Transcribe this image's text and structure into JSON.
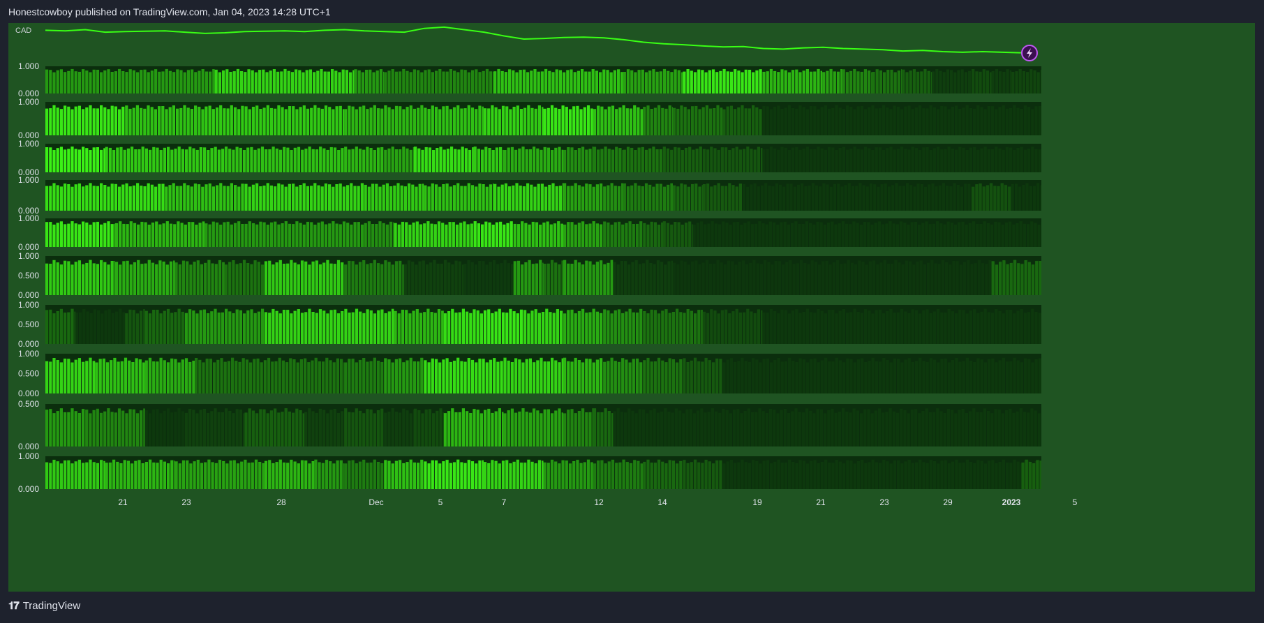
{
  "header": {
    "title": "Honestcowboy published on TradingView.com, Jan 04, 2023 14:28 UTC+1"
  },
  "footer": {
    "brand": "TradingView"
  },
  "colors": {
    "background": "#1e222d",
    "pane": "#1f5422",
    "line": "#39ff14",
    "bright": "#3bf016",
    "dark": "#0b2e0d",
    "badge": "#c158f5"
  },
  "icons": {
    "badge": "lightning-icon",
    "logo": "tradingview-logo-icon"
  },
  "chart_data": {
    "type": "heatmap",
    "price_label": "CAD",
    "x_ticks": [
      "21",
      "23",
      "28",
      "Dec",
      "5",
      "7",
      "12",
      "14",
      "19",
      "21",
      "23",
      "29",
      "2023",
      "5"
    ],
    "bold_ticks": [
      "2023"
    ],
    "price_line_shape": [
      0.12,
      0.14,
      0.1,
      0.18,
      0.16,
      0.15,
      0.14,
      0.18,
      0.22,
      0.2,
      0.16,
      0.15,
      0.14,
      0.16,
      0.12,
      0.1,
      0.14,
      0.16,
      0.18,
      0.06,
      0.02,
      0.1,
      0.18,
      0.3,
      0.4,
      0.38,
      0.35,
      0.34,
      0.36,
      0.42,
      0.5,
      0.55,
      0.58,
      0.62,
      0.65,
      0.64,
      0.7,
      0.72,
      0.68,
      0.66,
      0.7,
      0.72,
      0.74,
      0.78,
      0.76,
      0.8,
      0.82,
      0.8,
      0.82,
      0.84
    ],
    "panes": [
      {
        "ticks": [
          "1.000",
          "0.000"
        ],
        "segments": [
          [
            0.0,
            0.17,
            0.55
          ],
          [
            0.17,
            0.31,
            0.85
          ],
          [
            0.31,
            0.34,
            0.55
          ],
          [
            0.34,
            0.45,
            0.45
          ],
          [
            0.45,
            0.58,
            0.75
          ],
          [
            0.58,
            0.64,
            0.6
          ],
          [
            0.64,
            0.72,
            0.95
          ],
          [
            0.72,
            0.78,
            0.7
          ],
          [
            0.78,
            0.8,
            0.6
          ],
          [
            0.8,
            0.83,
            0.45
          ],
          [
            0.83,
            0.86,
            0.35
          ],
          [
            0.86,
            0.89,
            0.25
          ],
          [
            0.89,
            0.93,
            0.08
          ],
          [
            0.93,
            0.95,
            0.15
          ],
          [
            0.95,
            0.97,
            0.08
          ],
          [
            0.97,
            1.0,
            0.12
          ]
        ]
      },
      {
        "ticks": [
          "1.000",
          "0.000"
        ],
        "segments": [
          [
            0.0,
            0.08,
            0.95
          ],
          [
            0.08,
            0.16,
            0.75
          ],
          [
            0.16,
            0.3,
            0.8
          ],
          [
            0.3,
            0.38,
            0.7
          ],
          [
            0.38,
            0.44,
            0.75
          ],
          [
            0.44,
            0.48,
            0.85
          ],
          [
            0.48,
            0.5,
            0.8
          ],
          [
            0.5,
            0.55,
            0.95
          ],
          [
            0.55,
            0.6,
            0.75
          ],
          [
            0.6,
            0.63,
            0.45
          ],
          [
            0.63,
            0.68,
            0.35
          ],
          [
            0.68,
            0.72,
            0.25
          ],
          [
            0.72,
            1.0,
            0.05
          ]
        ]
      },
      {
        "ticks": [
          "1.000",
          "0.000"
        ],
        "segments": [
          [
            0.0,
            0.06,
            1.0
          ],
          [
            0.06,
            0.18,
            0.8
          ],
          [
            0.18,
            0.3,
            0.75
          ],
          [
            0.3,
            0.34,
            0.7
          ],
          [
            0.34,
            0.37,
            0.6
          ],
          [
            0.37,
            0.43,
            0.9
          ],
          [
            0.43,
            0.46,
            0.8
          ],
          [
            0.46,
            0.52,
            0.65
          ],
          [
            0.52,
            0.55,
            0.5
          ],
          [
            0.55,
            0.58,
            0.4
          ],
          [
            0.58,
            0.62,
            0.35
          ],
          [
            0.62,
            0.66,
            0.25
          ],
          [
            0.66,
            0.72,
            0.2
          ],
          [
            0.72,
            1.0,
            0.05
          ]
        ]
      },
      {
        "ticks": [
          "1.000",
          "0.000"
        ],
        "segments": [
          [
            0.0,
            0.12,
            0.9
          ],
          [
            0.12,
            0.2,
            0.75
          ],
          [
            0.2,
            0.32,
            0.85
          ],
          [
            0.32,
            0.38,
            0.8
          ],
          [
            0.38,
            0.45,
            0.75
          ],
          [
            0.45,
            0.52,
            0.85
          ],
          [
            0.52,
            0.56,
            0.6
          ],
          [
            0.56,
            0.58,
            0.5
          ],
          [
            0.58,
            0.63,
            0.4
          ],
          [
            0.63,
            0.66,
            0.3
          ],
          [
            0.66,
            0.7,
            0.22
          ],
          [
            0.7,
            1.0,
            0.05
          ],
          [
            0.93,
            0.97,
            0.18
          ]
        ]
      },
      {
        "ticks": [
          "1.000",
          "0.000"
        ],
        "segments": [
          [
            0.0,
            0.07,
            0.95
          ],
          [
            0.07,
            0.16,
            0.7
          ],
          [
            0.16,
            0.32,
            0.55
          ],
          [
            0.32,
            0.35,
            0.5
          ],
          [
            0.35,
            0.43,
            0.85
          ],
          [
            0.43,
            0.47,
            0.95
          ],
          [
            0.47,
            0.52,
            0.75
          ],
          [
            0.52,
            0.56,
            0.6
          ],
          [
            0.56,
            0.6,
            0.4
          ],
          [
            0.6,
            0.62,
            0.3
          ],
          [
            0.62,
            0.65,
            0.22
          ],
          [
            0.65,
            1.0,
            0.05
          ]
        ]
      },
      {
        "ticks": [
          "1.000",
          "0.500",
          "0.000"
        ],
        "segments": [
          [
            0.0,
            0.07,
            0.8
          ],
          [
            0.07,
            0.13,
            0.65
          ],
          [
            0.13,
            0.18,
            0.45
          ],
          [
            0.18,
            0.22,
            0.35
          ],
          [
            0.22,
            0.3,
            0.8
          ],
          [
            0.3,
            0.36,
            0.4
          ],
          [
            0.36,
            0.42,
            0.1
          ],
          [
            0.42,
            0.47,
            0.06
          ],
          [
            0.47,
            0.5,
            0.55
          ],
          [
            0.5,
            0.52,
            0.35
          ],
          [
            0.52,
            0.57,
            0.55
          ],
          [
            0.57,
            0.63,
            0.08
          ],
          [
            0.63,
            1.0,
            0.04
          ],
          [
            0.95,
            1.0,
            0.3
          ]
        ]
      },
      {
        "ticks": [
          "1.000",
          "0.500",
          "0.000"
        ],
        "segments": [
          [
            0.0,
            0.03,
            0.3
          ],
          [
            0.03,
            0.08,
            0.05
          ],
          [
            0.08,
            0.1,
            0.2
          ],
          [
            0.1,
            0.14,
            0.3
          ],
          [
            0.14,
            0.22,
            0.55
          ],
          [
            0.22,
            0.35,
            0.85
          ],
          [
            0.35,
            0.4,
            0.7
          ],
          [
            0.4,
            0.44,
            0.9
          ],
          [
            0.44,
            0.48,
            0.95
          ],
          [
            0.48,
            0.52,
            0.85
          ],
          [
            0.52,
            0.56,
            0.65
          ],
          [
            0.56,
            0.6,
            0.5
          ],
          [
            0.6,
            0.66,
            0.35
          ],
          [
            0.66,
            0.72,
            0.15
          ],
          [
            0.72,
            1.0,
            0.05
          ]
        ]
      },
      {
        "ticks": [
          "1.000",
          "0.500",
          "0.000"
        ],
        "segments": [
          [
            0.0,
            0.05,
            0.85
          ],
          [
            0.05,
            0.1,
            0.75
          ],
          [
            0.1,
            0.15,
            0.65
          ],
          [
            0.15,
            0.3,
            0.35
          ],
          [
            0.3,
            0.34,
            0.4
          ],
          [
            0.34,
            0.38,
            0.55
          ],
          [
            0.38,
            0.46,
            0.9
          ],
          [
            0.46,
            0.52,
            0.85
          ],
          [
            0.52,
            0.56,
            0.7
          ],
          [
            0.56,
            0.6,
            0.5
          ],
          [
            0.6,
            0.64,
            0.35
          ],
          [
            0.64,
            0.68,
            0.22
          ],
          [
            0.68,
            1.0,
            0.05
          ]
        ]
      },
      {
        "ticks": [
          "0.500",
          "0.000"
        ],
        "segments": [
          [
            0.0,
            0.04,
            0.55
          ],
          [
            0.04,
            0.1,
            0.45
          ],
          [
            0.1,
            0.14,
            0.05
          ],
          [
            0.14,
            0.2,
            0.1
          ],
          [
            0.2,
            0.26,
            0.25
          ],
          [
            0.26,
            0.3,
            0.1
          ],
          [
            0.3,
            0.34,
            0.2
          ],
          [
            0.34,
            0.37,
            0.08
          ],
          [
            0.37,
            0.4,
            0.15
          ],
          [
            0.4,
            0.46,
            0.7
          ],
          [
            0.46,
            0.52,
            0.6
          ],
          [
            0.52,
            0.55,
            0.45
          ],
          [
            0.55,
            0.57,
            0.3
          ],
          [
            0.57,
            1.0,
            0.05
          ]
        ]
      },
      {
        "ticks": [
          "1.000",
          "0.000"
        ],
        "segments": [
          [
            0.0,
            0.06,
            0.8
          ],
          [
            0.06,
            0.13,
            0.7
          ],
          [
            0.13,
            0.22,
            0.6
          ],
          [
            0.22,
            0.27,
            0.7
          ],
          [
            0.27,
            0.3,
            0.55
          ],
          [
            0.3,
            0.34,
            0.4
          ],
          [
            0.34,
            0.38,
            0.75
          ],
          [
            0.38,
            0.44,
            0.95
          ],
          [
            0.44,
            0.5,
            0.85
          ],
          [
            0.5,
            0.55,
            0.55
          ],
          [
            0.55,
            0.6,
            0.4
          ],
          [
            0.6,
            0.64,
            0.3
          ],
          [
            0.64,
            0.68,
            0.22
          ],
          [
            0.68,
            1.0,
            0.05
          ],
          [
            0.98,
            1.0,
            0.25
          ]
        ]
      }
    ]
  }
}
